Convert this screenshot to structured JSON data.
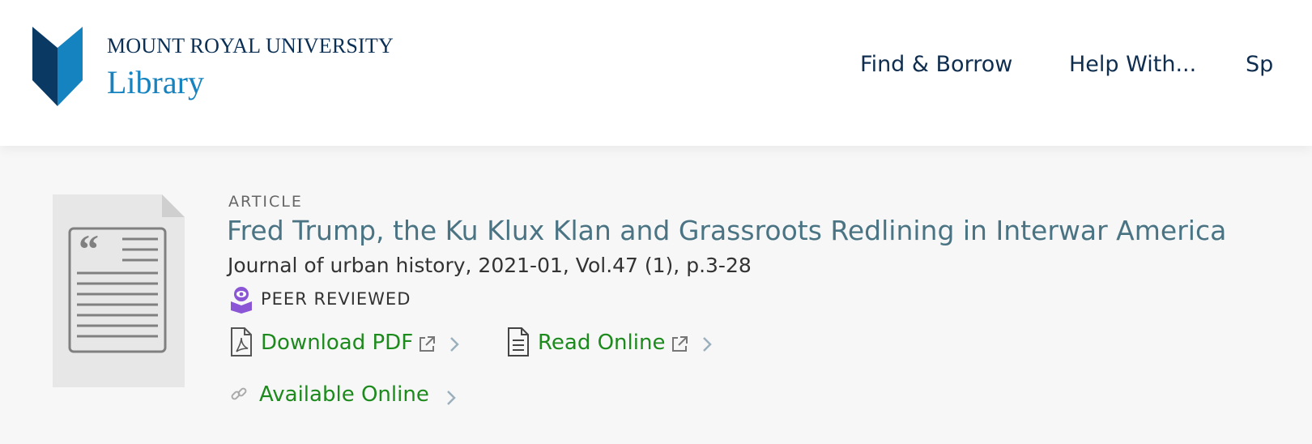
{
  "header": {
    "logo": {
      "line1": "MOUNT ROYAL UNIVERSITY",
      "line2": "Library",
      "colors": {
        "dark": "#0a3a64",
        "light": "#1583bf"
      }
    },
    "nav": [
      {
        "label": "Find & Borrow"
      },
      {
        "label": "Help With..."
      },
      {
        "label": "Sp"
      }
    ]
  },
  "record": {
    "thumbnail_icon": "quote-document-icon",
    "type": "ARTICLE",
    "title": "Fred Trump, the Ku Klux Klan and Grassroots Redlining in Interwar America",
    "citation": "Journal of urban history, 2021-01, Vol.47 (1), p.3-28",
    "peer_reviewed": {
      "label": "PEER REVIEWED",
      "icon": "peer-reviewed-icon",
      "color": "#8a56d6"
    },
    "links": [
      {
        "label": "Download PDF",
        "icon": "pdf-icon",
        "external": true
      },
      {
        "label": "Read Online",
        "icon": "document-icon",
        "external": true
      },
      {
        "label": "Available Online",
        "icon": "link-icon",
        "external": false
      }
    ],
    "link_color": "#1c8a1c"
  }
}
